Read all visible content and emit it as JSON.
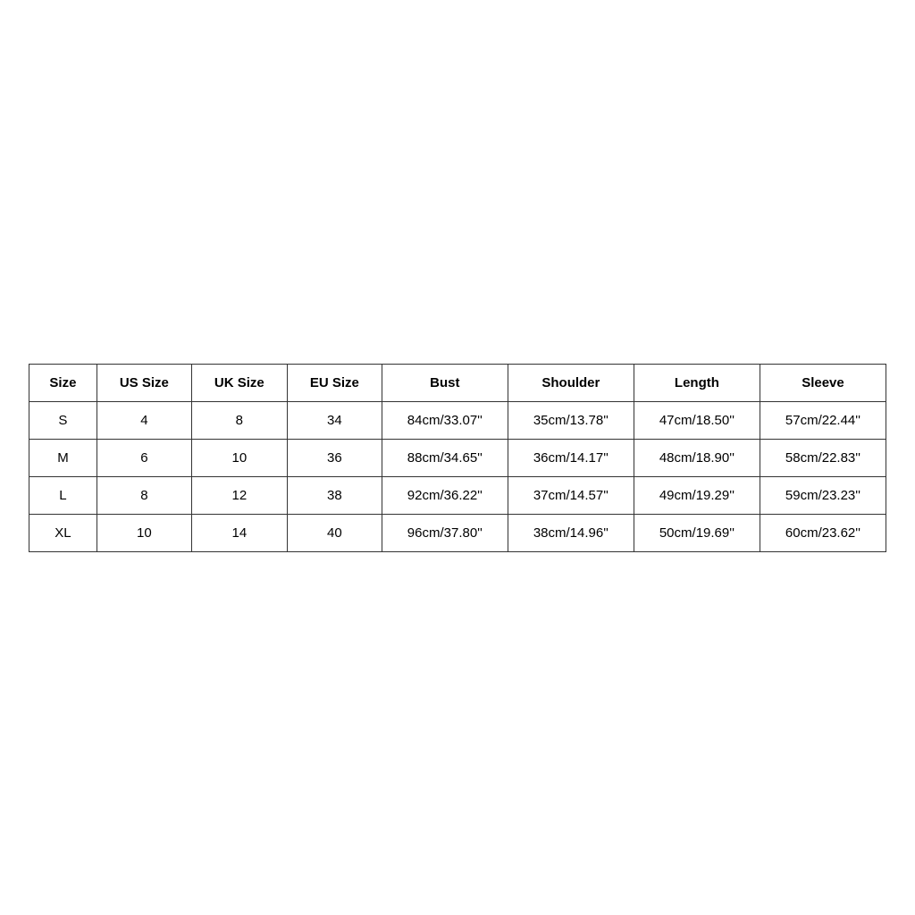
{
  "table": {
    "headers": [
      "Size",
      "US Size",
      "UK Size",
      "EU Size",
      "Bust",
      "Shoulder",
      "Length",
      "Sleeve"
    ],
    "rows": [
      [
        "S",
        "4",
        "8",
        "34",
        "84cm/33.07''",
        "35cm/13.78''",
        "47cm/18.50''",
        "57cm/22.44''"
      ],
      [
        "M",
        "6",
        "10",
        "36",
        "88cm/34.65''",
        "36cm/14.17''",
        "48cm/18.90''",
        "58cm/22.83''"
      ],
      [
        "L",
        "8",
        "12",
        "38",
        "92cm/36.22''",
        "37cm/14.57''",
        "49cm/19.29''",
        "59cm/23.23''"
      ],
      [
        "XL",
        "10",
        "14",
        "40",
        "96cm/37.80''",
        "38cm/14.96''",
        "50cm/19.69''",
        "60cm/23.62''"
      ]
    ]
  }
}
